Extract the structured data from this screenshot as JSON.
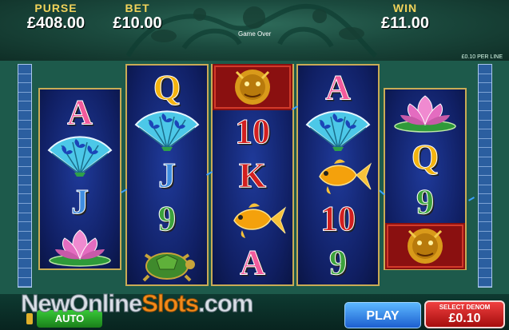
{
  "hud": {
    "purse_label": "PURSE",
    "purse_value": "£408.00",
    "bet_label": "BET",
    "bet_value": "£10.00",
    "win_label": "WIN",
    "win_value": "£11.00",
    "status": "Game Over",
    "per_line": "£0.10 PER LINE"
  },
  "reels": [
    [
      {
        "type": "letter",
        "glyph": "A",
        "color": "pink"
      },
      {
        "type": "fan",
        "icon": "butterfly-fan-icon"
      },
      {
        "type": "letter",
        "glyph": "J",
        "color": "blue"
      },
      {
        "type": "lotus",
        "icon": "lotus-flower-icon"
      }
    ],
    [
      {
        "type": "letter",
        "glyph": "Q",
        "color": "gold"
      },
      {
        "type": "fan",
        "icon": "butterfly-fan-icon"
      },
      {
        "type": "letter",
        "glyph": "J",
        "color": "blue"
      },
      {
        "type": "letter",
        "glyph": "9",
        "color": "green"
      },
      {
        "type": "turtle",
        "icon": "turtle-icon"
      }
    ],
    [
      {
        "type": "dragon",
        "icon": "dragon-icon"
      },
      {
        "type": "letter",
        "glyph": "10",
        "color": "red"
      },
      {
        "type": "letter",
        "glyph": "K",
        "color": "red"
      },
      {
        "type": "fish",
        "icon": "goldfish-icon"
      },
      {
        "type": "letter",
        "glyph": "A",
        "color": "pink"
      }
    ],
    [
      {
        "type": "letter",
        "glyph": "A",
        "color": "pink"
      },
      {
        "type": "fan",
        "icon": "butterfly-fan-icon"
      },
      {
        "type": "fish",
        "icon": "goldfish-icon"
      },
      {
        "type": "letter",
        "glyph": "10",
        "color": "red"
      },
      {
        "type": "letter",
        "glyph": "9",
        "color": "green"
      }
    ],
    [
      {
        "type": "lotus",
        "icon": "lotus-flower-icon"
      },
      {
        "type": "letter",
        "glyph": "Q",
        "color": "gold"
      },
      {
        "type": "letter",
        "glyph": "9",
        "color": "green"
      },
      {
        "type": "dragon",
        "icon": "dragon-icon"
      }
    ]
  ],
  "controls": {
    "auto_label": "AUTO",
    "play_label": "PLAY",
    "denom_label": "SELECT DENOM",
    "denom_value": "£0.10"
  },
  "watermark": {
    "part1": "New",
    "part2": "Online",
    "part3": "Slots",
    "part4": ".com"
  },
  "colors": {
    "pink": "#f25b9c",
    "blue": "#3f8de0",
    "green": "#3ca23c",
    "gold": "#f4b410",
    "red": "#d11f1f"
  }
}
